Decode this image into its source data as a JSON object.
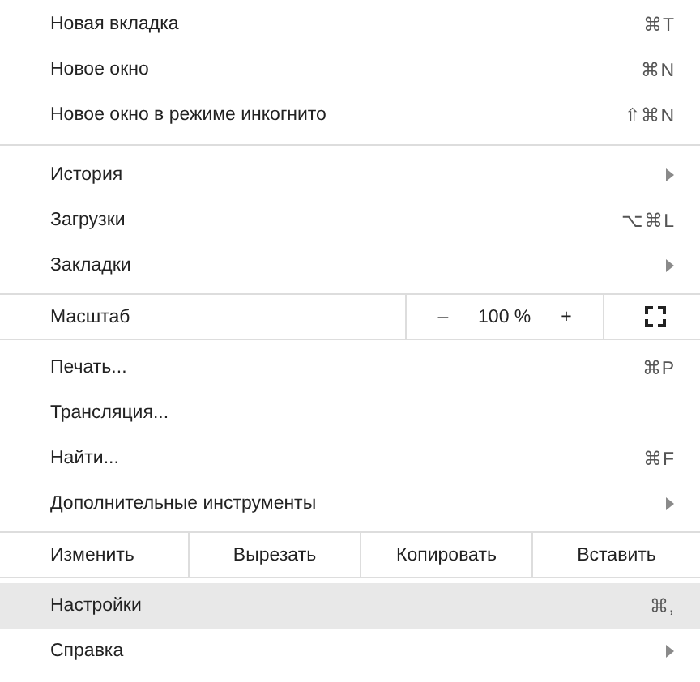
{
  "sections": [
    {
      "kind": "list",
      "items": [
        {
          "label": "Новая вкладка",
          "shortcut": "⌘T",
          "submenu": false,
          "selected": false
        },
        {
          "label": "Новое окно",
          "shortcut": "⌘N",
          "submenu": false,
          "selected": false
        },
        {
          "label": "Новое окно в режиме инкогнито",
          "shortcut": "⇧⌘N",
          "submenu": false,
          "selected": false
        }
      ]
    },
    {
      "kind": "list",
      "items": [
        {
          "label": "История",
          "submenu": true,
          "selected": false
        },
        {
          "label": "Загрузки",
          "shortcut": "⌥⌘L",
          "submenu": false,
          "selected": false
        },
        {
          "label": "Закладки",
          "submenu": true,
          "selected": false
        }
      ]
    },
    {
      "kind": "zoom",
      "label": "Масштаб",
      "minus": "–",
      "value": "100 %",
      "plus": "+"
    },
    {
      "kind": "list",
      "items": [
        {
          "label": "Печать...",
          "shortcut": "⌘P",
          "submenu": false,
          "selected": false
        },
        {
          "label": "Трансляция...",
          "submenu": false,
          "selected": false
        },
        {
          "label": "Найти...",
          "shortcut": "⌘F",
          "submenu": false,
          "selected": false
        },
        {
          "label": "Дополнительные инструменты",
          "submenu": true,
          "selected": false
        }
      ]
    },
    {
      "kind": "edit",
      "label": "Изменить",
      "buttons": [
        "Вырезать",
        "Копировать",
        "Вставить"
      ]
    },
    {
      "kind": "list",
      "items": [
        {
          "label": "Настройки",
          "shortcut": "⌘,",
          "submenu": false,
          "selected": true
        },
        {
          "label": "Справка",
          "submenu": true,
          "selected": false
        }
      ]
    }
  ]
}
